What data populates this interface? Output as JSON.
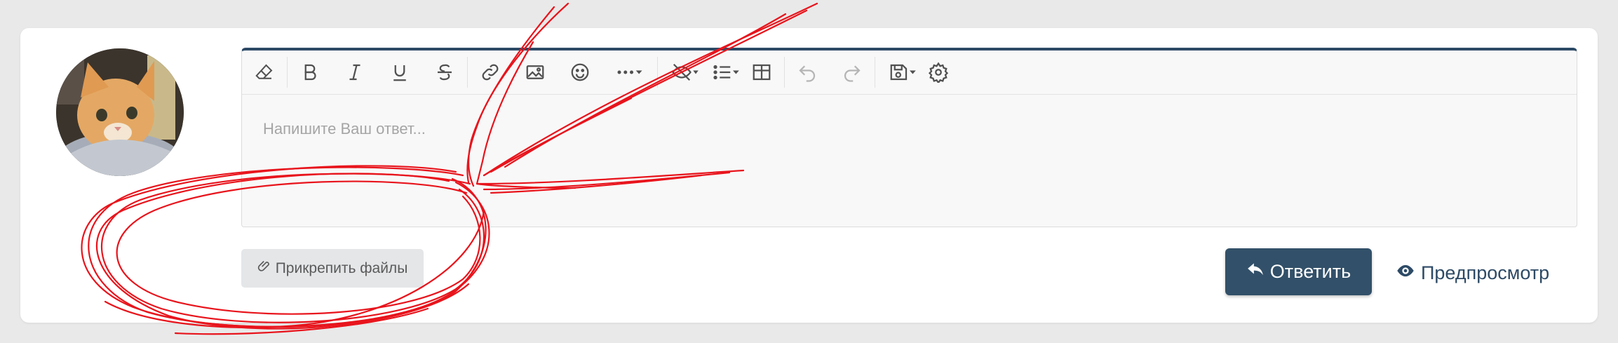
{
  "editor": {
    "placeholder": "Напишите Ваш ответ...",
    "toolbar": [
      {
        "name": "clear-format-icon"
      },
      {
        "name": "bold-icon"
      },
      {
        "name": "italic-icon"
      },
      {
        "name": "underline-icon"
      },
      {
        "name": "strikethrough-icon"
      },
      {
        "name": "link-icon"
      },
      {
        "name": "image-icon"
      },
      {
        "name": "emoji-icon"
      },
      {
        "name": "more-options-icon"
      },
      {
        "name": "hide-icon"
      },
      {
        "name": "list-icon"
      },
      {
        "name": "table-icon"
      },
      {
        "name": "undo-icon"
      },
      {
        "name": "redo-icon"
      },
      {
        "name": "drafts-icon"
      },
      {
        "name": "settings-icon"
      }
    ]
  },
  "actions": {
    "attach_label": "Прикрепить файлы",
    "reply_label": "Ответить",
    "preview_label": "Предпросмотр"
  },
  "colors": {
    "accent": "#325069",
    "annotation": "#e8141c"
  }
}
